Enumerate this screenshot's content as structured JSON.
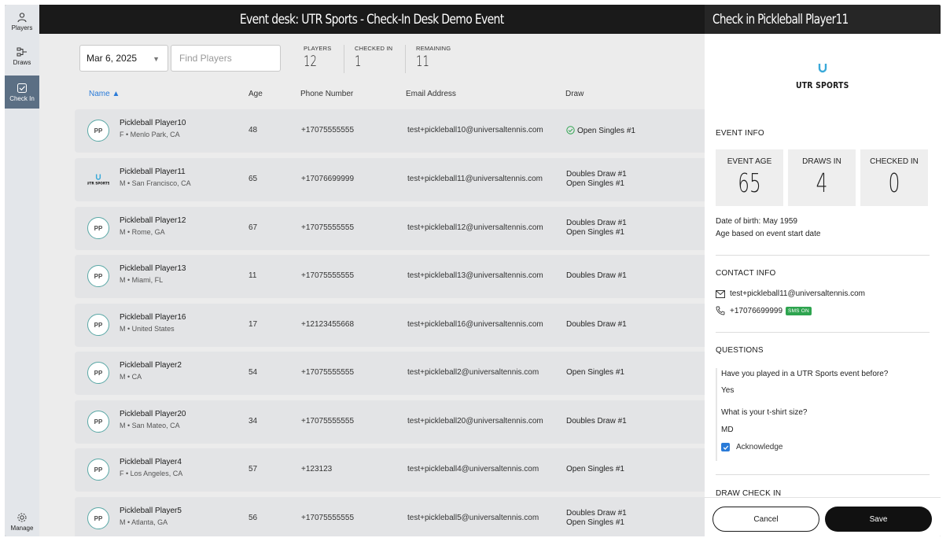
{
  "nav": {
    "players": "Players",
    "draws": "Draws",
    "checkin": "Check In",
    "manage": "Manage"
  },
  "header": {
    "title": "Event desk: UTR Sports - Check-In Desk Demo Event"
  },
  "toolbar": {
    "date": "Mar 6, 2025",
    "search_placeholder": "Find Players",
    "stats": [
      {
        "label": "PLAYERS",
        "value": "12"
      },
      {
        "label": "CHECKED IN",
        "value": "1"
      },
      {
        "label": "REMAINING",
        "value": "11"
      }
    ]
  },
  "table": {
    "headers": {
      "name": "Name ▲",
      "age": "Age",
      "phone": "Phone Number",
      "email": "Email Address",
      "draw": "Draw"
    },
    "rows": [
      {
        "initials": "PP",
        "name": "Pickleball Player10",
        "loc": "F • Menlo Park, CA",
        "age": "48",
        "phone": "+17075555555",
        "email": "test+pickleball10@universaltennis.com",
        "draw1": "Open Singles #1",
        "draw2": ""
      },
      {
        "initials": "UTR SPORTS",
        "name": "Pickleball Player11",
        "loc": "M • San Francisco, CA",
        "age": "65",
        "phone": "+17076699999",
        "email": "test+pickleball11@universaltennis.com",
        "draw1": "Doubles Draw #1",
        "draw2": "Open Singles #1"
      },
      {
        "initials": "PP",
        "name": "Pickleball Player12",
        "loc": "M • Rome, GA",
        "age": "67",
        "phone": "+17075555555",
        "email": "test+pickleball12@universaltennis.com",
        "draw1": "Doubles Draw #1",
        "draw2": "Open Singles #1"
      },
      {
        "initials": "PP",
        "name": "Pickleball Player13",
        "loc": "M • Miami, FL",
        "age": "11",
        "phone": "+17075555555",
        "email": "test+pickleball13@universaltennis.com",
        "draw1": "Doubles Draw #1",
        "draw2": ""
      },
      {
        "initials": "PP",
        "name": "Pickleball Player16",
        "loc": "M • United States",
        "age": "17",
        "phone": "+12123455668",
        "email": "test+pickleball16@universaltennis.com",
        "draw1": "Doubles Draw #1",
        "draw2": ""
      },
      {
        "initials": "PP",
        "name": "Pickleball Player2",
        "loc": "M • CA",
        "age": "54",
        "phone": "+17075555555",
        "email": "test+pickleball2@universaltennis.com",
        "draw1": "Open Singles #1",
        "draw2": ""
      },
      {
        "initials": "PP",
        "name": "Pickleball Player20",
        "loc": "M • San Mateo, CA",
        "age": "34",
        "phone": "+17075555555",
        "email": "test+pickleball20@universaltennis.com",
        "draw1": "Doubles Draw #1",
        "draw2": ""
      },
      {
        "initials": "PP",
        "name": "Pickleball Player4",
        "loc": "F • Los Angeles, CA",
        "age": "57",
        "phone": "+123123",
        "email": "test+pickleball4@universaltennis.com",
        "draw1": "Open Singles #1",
        "draw2": ""
      },
      {
        "initials": "PP",
        "name": "Pickleball Player5",
        "loc": "M • Atlanta, GA",
        "age": "56",
        "phone": "+17075555555",
        "email": "test+pickleball5@universaltennis.com",
        "draw1": "Doubles Draw #1",
        "draw2": "Open Singles #1"
      }
    ]
  },
  "panel": {
    "title": "Check in Pickleball Player11",
    "logo": "UTR SPORTS",
    "event_info": "EVENT INFO",
    "boxes": [
      {
        "label": "EVENT AGE",
        "value": "65"
      },
      {
        "label": "DRAWS IN",
        "value": "4"
      },
      {
        "label": "CHECKED IN",
        "value": "0"
      }
    ],
    "dob": "Date of birth: May 1959",
    "age_note": "Age based on event start date",
    "contact_info": "CONTACT INFO",
    "email": "test+pickleball11@universaltennis.com",
    "phone": "+17076699999",
    "sms": "SMS ON",
    "questions": "QUESTIONS",
    "q1": "Have you played in a UTR Sports event before?",
    "a1": "Yes",
    "q2": "What is your t-shirt size?",
    "a2": "MD",
    "ack": "Acknowledge",
    "draw_checkin": "DRAW CHECK IN",
    "cancel": "Cancel",
    "save": "Save"
  },
  "colors": {
    "accent": "#2a7bd8",
    "sms": "#2ea44f",
    "nav_active": "#5b6f84",
    "avatar_ring": "#5aa8a6"
  }
}
